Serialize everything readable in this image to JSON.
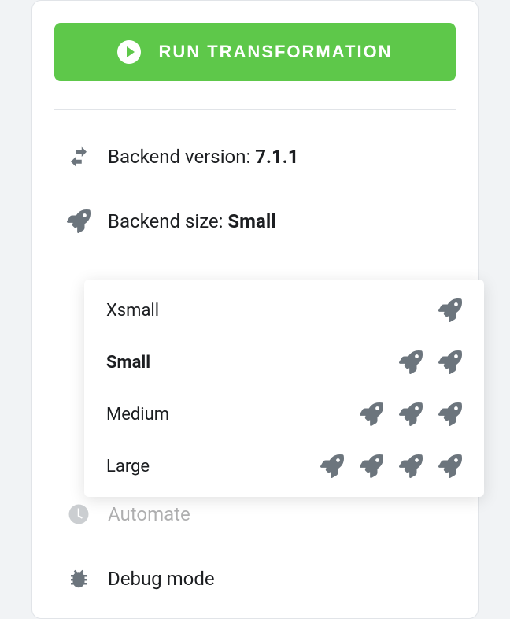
{
  "runButton": {
    "label": "RUN TRANSFORMATION"
  },
  "backendVersion": {
    "label": "Backend version: ",
    "value": "7.1.1"
  },
  "backendSize": {
    "label": "Backend size: ",
    "value": "Small"
  },
  "sizeOptions": [
    {
      "label": "Xsmall",
      "rockets": 1,
      "selected": false
    },
    {
      "label": "Small",
      "rockets": 2,
      "selected": true
    },
    {
      "label": "Medium",
      "rockets": 3,
      "selected": false
    },
    {
      "label": "Large",
      "rockets": 4,
      "selected": false
    }
  ],
  "automate": {
    "label": "Automate"
  },
  "debugMode": {
    "label": "Debug mode"
  }
}
